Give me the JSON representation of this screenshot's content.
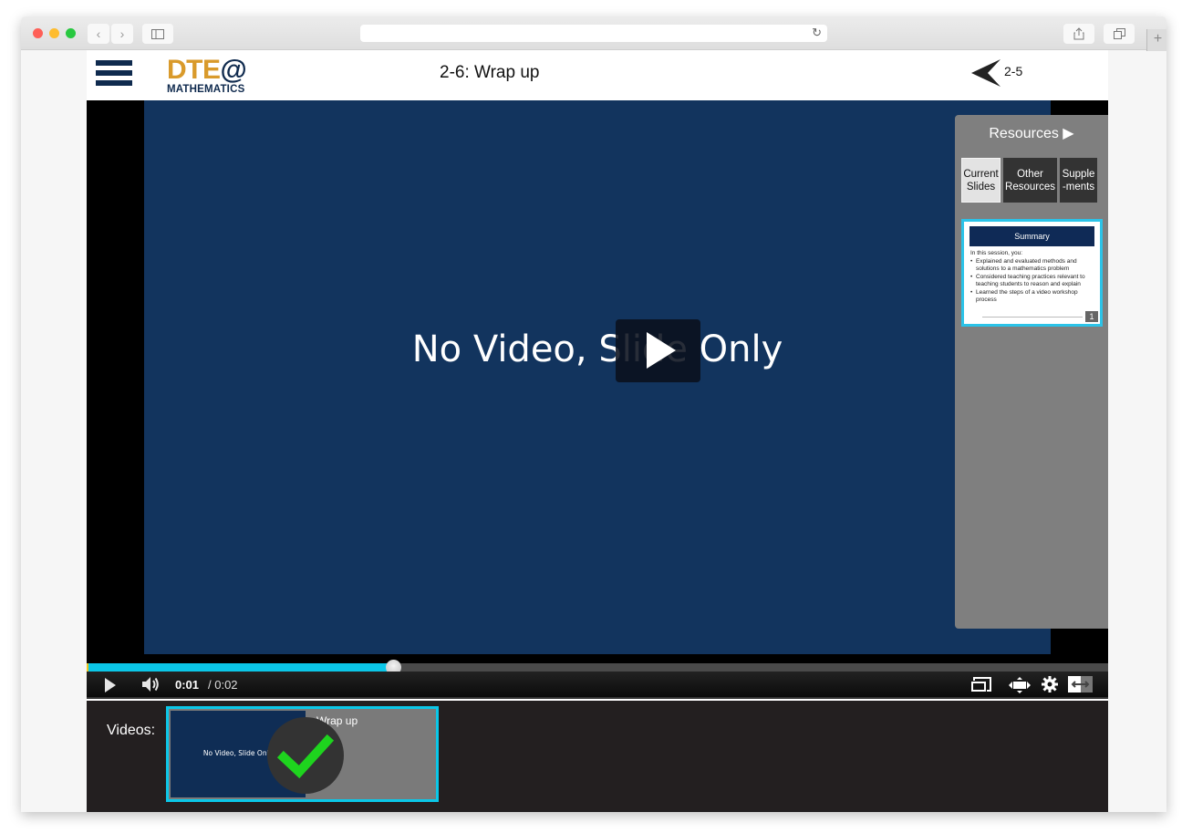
{
  "browser": {
    "url": "",
    "nav_back_icon": "chevron-left-icon",
    "nav_forward_icon": "chevron-right-icon",
    "sidebar_icon": "sidebar-icon",
    "reload_icon": "reload-icon",
    "share_icon": "share-icon",
    "tabs_icon": "tabs-icon",
    "new_tab_label": "+"
  },
  "header": {
    "menu_icon": "hamburger-icon",
    "logo_top": "DTE",
    "logo_at": "@",
    "logo_bottom": "MATHEMATICS",
    "title": "2-6: Wrap up",
    "prev_label": "2-5"
  },
  "player": {
    "slide_text": "No Video, Slide Only",
    "progress_fraction": 0.3,
    "time_current": "0:01",
    "time_total": "/ 0:02",
    "accent_color": "#0bc7e8"
  },
  "resources": {
    "title": "Resources ▶",
    "tabs": [
      {
        "line1": "Current",
        "line2": "Slides",
        "active": true
      },
      {
        "line1": "Other",
        "line2": "Resources",
        "active": false
      },
      {
        "line1": "Supple",
        "line2": "-ments",
        "active": false
      }
    ],
    "slide": {
      "heading": "Summary",
      "intro": "In this session, you:",
      "bullets": [
        "Explained and evaluated methods and solutions to a mathematics problem",
        "Considered teaching practices relevant to teaching students to reason and explain",
        "Learned the steps of a video workshop process"
      ],
      "number": "1"
    }
  },
  "videos": {
    "label": "Videos:",
    "items": [
      {
        "thumb_text": "No Video, Slide Only",
        "title": "Wrap up",
        "completed": true
      }
    ]
  }
}
